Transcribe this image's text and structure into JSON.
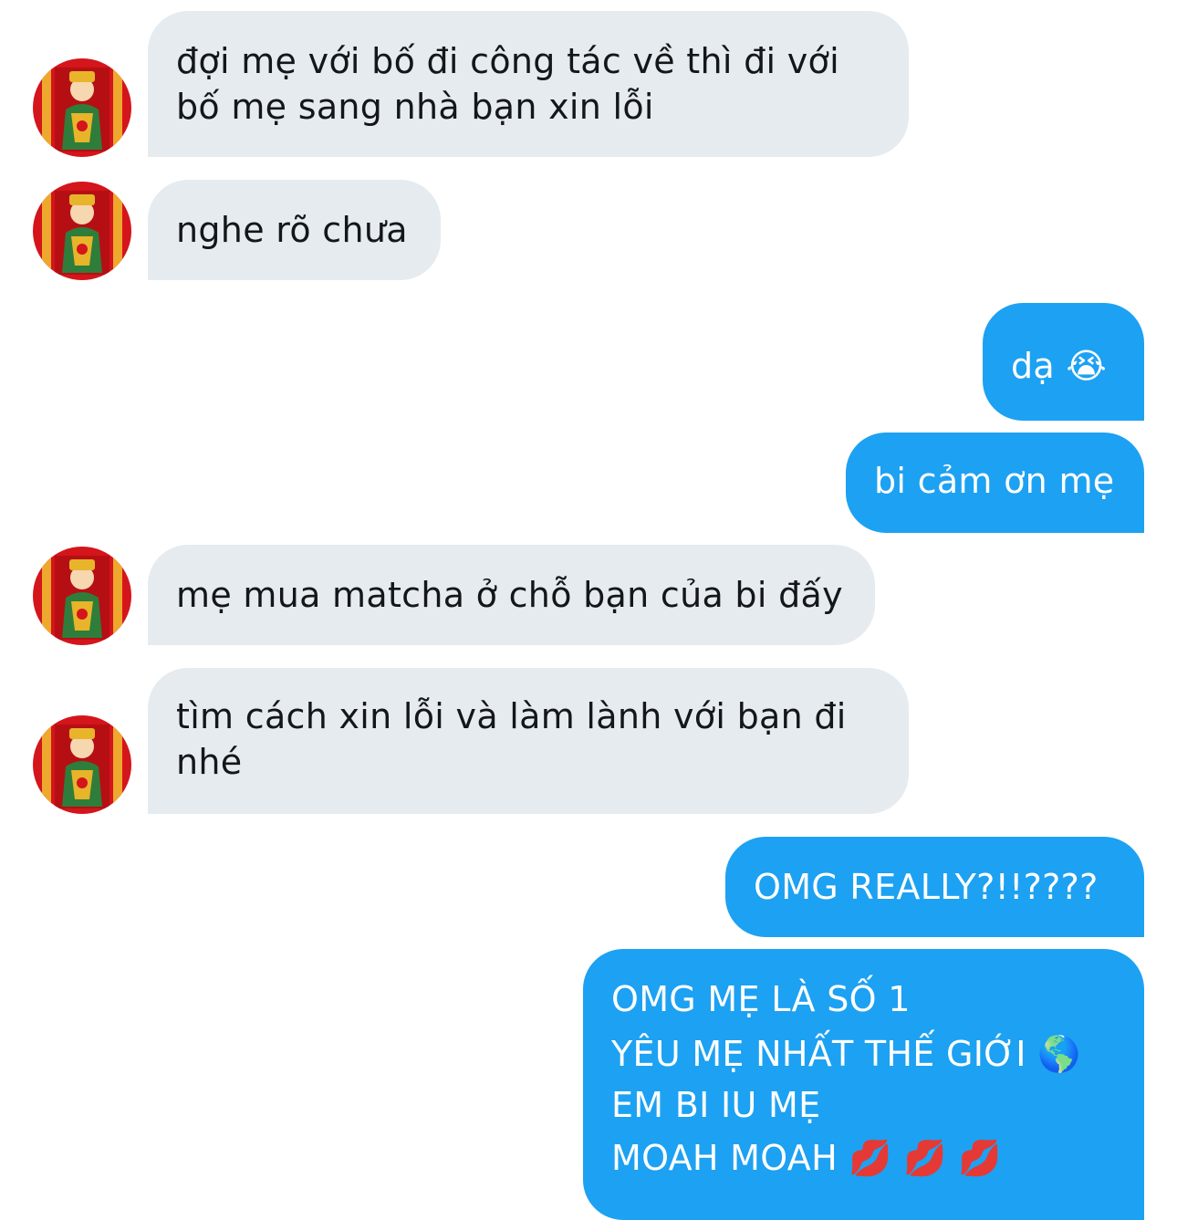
{
  "colors": {
    "incoming_bubble": "#e6ebef",
    "outgoing_bubble": "#1da1f2",
    "incoming_text": "#14171a",
    "outgoing_text": "#ffffff",
    "avatar_red": "#d4151b",
    "avatar_gold": "#f2c230"
  },
  "avatar": {
    "icon": "god-of-wealth-avatar-icon"
  },
  "messages": [
    {
      "direction": "incoming",
      "lines": [
        "đợi mẹ với bố đi công tác về thì đi với",
        "bố mẹ sang nhà bạn xin lỗi"
      ]
    },
    {
      "direction": "incoming",
      "lines": [
        "nghe rõ chưa"
      ]
    },
    {
      "direction": "outgoing",
      "lines": [
        "dạ 😭"
      ]
    },
    {
      "direction": "outgoing",
      "lines": [
        "bi cảm ơn mẹ"
      ]
    },
    {
      "direction": "incoming",
      "lines": [
        "mẹ mua matcha ở chỗ bạn của bi đấy"
      ]
    },
    {
      "direction": "incoming",
      "lines": [
        "tìm cách xin lỗi và làm lành với bạn đi",
        "nhé"
      ]
    },
    {
      "direction": "outgoing",
      "lines": [
        "OMG REALLY?!!????"
      ]
    },
    {
      "direction": "outgoing",
      "lines": [
        "OMG MẸ LÀ SỐ 1",
        "YÊU MẸ NHẤT THẾ GIỚI 🌎",
        "EM BI IU MẸ",
        "MOAH MOAH 💋 💋 💋"
      ]
    }
  ]
}
